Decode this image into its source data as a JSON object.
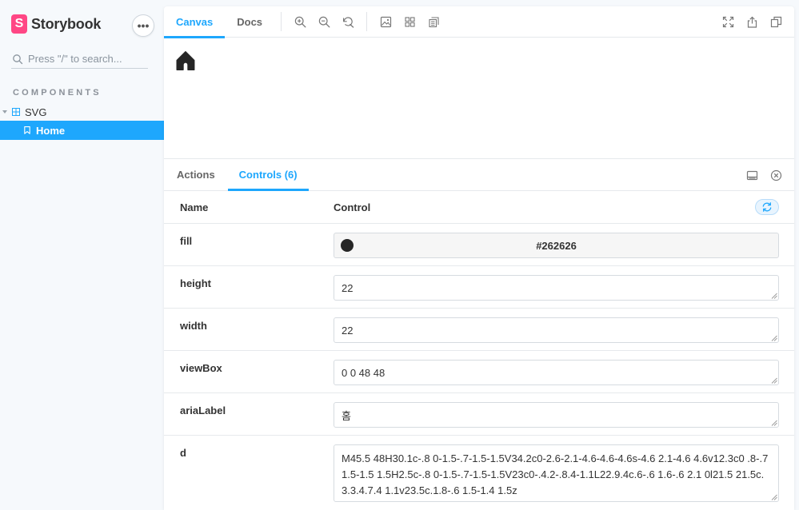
{
  "sidebar": {
    "brand_logo_letter": "S",
    "brand_name": "Storybook",
    "menu_label": "•••",
    "search_placeholder": "Press \"/\" to search...",
    "section_title": "COMPONENTS",
    "group_label": "SVG",
    "active_item_label": "Home"
  },
  "toolbar": {
    "tabs": [
      {
        "label": "Canvas",
        "active": true
      },
      {
        "label": "Docs",
        "active": false
      }
    ],
    "tools": [
      "zoom-in-icon",
      "zoom-out-icon",
      "zoom-reset-icon",
      "image-icon",
      "grid-icon",
      "outline-icon"
    ],
    "right_tools": [
      "fullscreen-icon",
      "share-icon",
      "copy-icon"
    ]
  },
  "canvas": {
    "rendered_icon": "home-icon",
    "icon_fill": "#262626"
  },
  "addons": {
    "tabs": [
      {
        "label": "Actions",
        "active": false
      },
      {
        "label": "Controls (6)",
        "active": true
      }
    ],
    "header": {
      "name": "Name",
      "control": "Control"
    },
    "controls": {
      "fill": {
        "name": "fill",
        "value": "#262626"
      },
      "height": {
        "name": "height",
        "value": "22"
      },
      "width": {
        "name": "width",
        "value": "22"
      },
      "viewBox": {
        "name": "viewBox",
        "value": "0 0 48 48"
      },
      "ariaLabel": {
        "name": "ariaLabel",
        "value": "홈"
      },
      "d": {
        "name": "d",
        "value": "M45.5 48H30.1c-.8 0-1.5-.7-1.5-1.5V34.2c0-2.6-2.1-4.6-4.6-4.6s-4.6 2.1-4.6 4.6v12.3c0 .8-.7 1.5-1.5 1.5H2.5c-.8 0-1.5-.7-1.5-1.5V23c0-.4.2-.8.4-1.1L22.9.4c.6-.6 1.6-.6 2.1 0l21.5 21.5c.3.3.4.7.4 1.1v23.5c.1.8-.6 1.5-1.4 1.5z"
      }
    }
  },
  "colors": {
    "accent": "#1ea7fd",
    "brand": "#ff4785"
  }
}
